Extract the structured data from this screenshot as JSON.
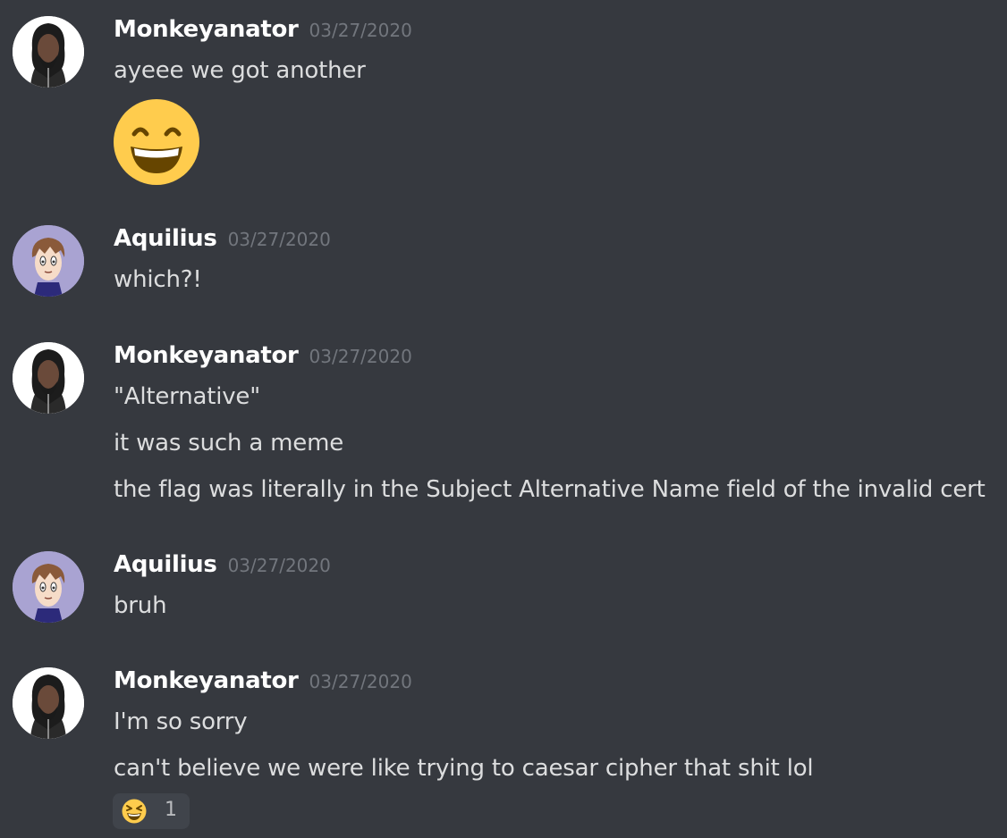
{
  "messages": [
    {
      "author": "Monkeyanator",
      "timestamp": "03/27/2020",
      "avatar": "monkeyanator-avatar",
      "lines": [
        "ayeee we got another"
      ],
      "emoji": "grinning-smiling-eyes-emoji"
    },
    {
      "author": "Aquilius",
      "timestamp": "03/27/2020",
      "avatar": "aquilius-avatar",
      "lines": [
        "which?!"
      ]
    },
    {
      "author": "Monkeyanator",
      "timestamp": "03/27/2020",
      "avatar": "monkeyanator-avatar",
      "lines": [
        "\"Alternative\"",
        "it was such a meme",
        "the flag was literally in the Subject Alternative Name field of the invalid cert"
      ]
    },
    {
      "author": "Aquilius",
      "timestamp": "03/27/2020",
      "avatar": "aquilius-avatar",
      "lines": [
        "bruh"
      ]
    },
    {
      "author": "Monkeyanator",
      "timestamp": "03/27/2020",
      "avatar": "monkeyanator-avatar",
      "lines": [
        "I'm so sorry",
        "can't believe we were like trying to caesar cipher that shit lol"
      ],
      "reaction": {
        "emoji": "laughing-emoji",
        "count": "1"
      }
    }
  ],
  "colors": {
    "background": "#36393f",
    "username": "#ffffff",
    "message_text": "#dcddde",
    "timestamp": "#72767d",
    "reaction_bg": "#40444b",
    "emoji_yellow": "#ffcc4d"
  }
}
